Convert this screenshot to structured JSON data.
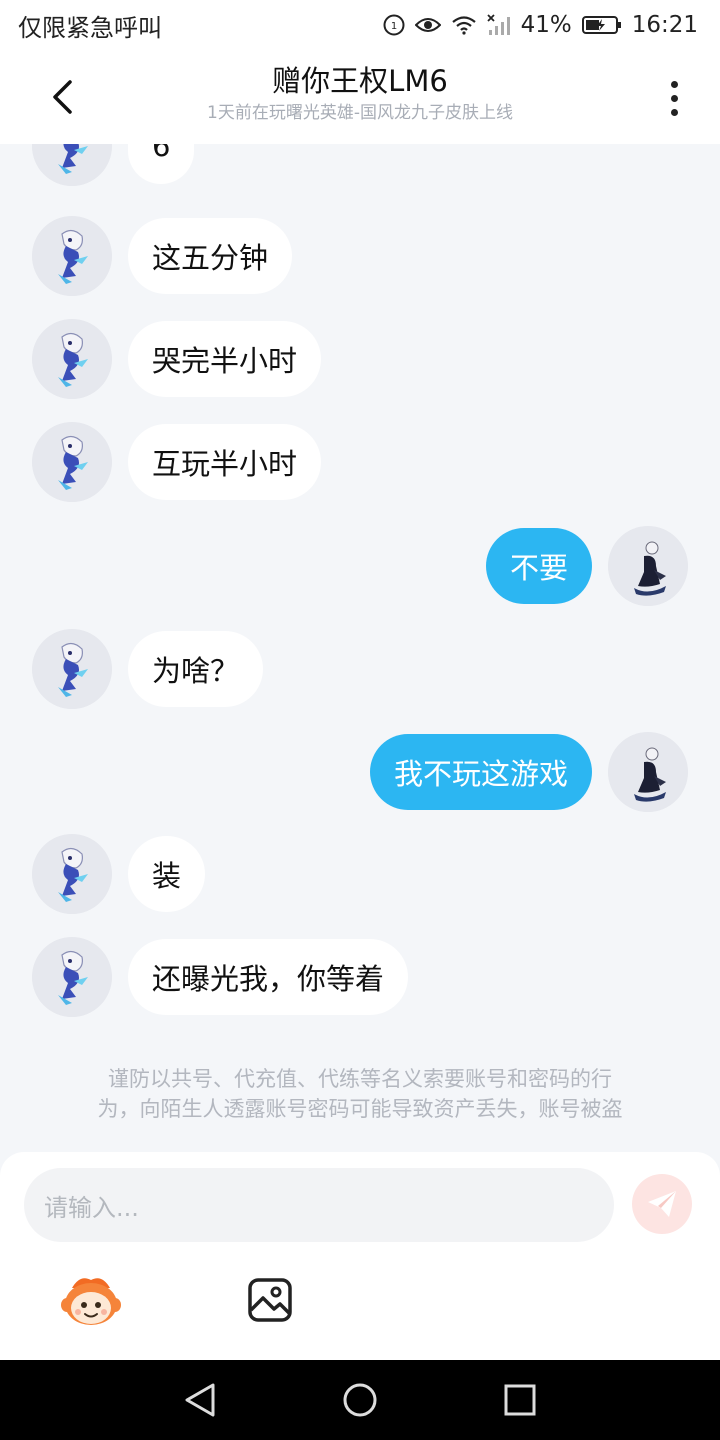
{
  "status_bar": {
    "left_text": "仅限紧急呼叫",
    "battery": "41%",
    "time": "16:21"
  },
  "header": {
    "title": "赠你王权LM6",
    "subtitle": "1天前在玩曙光英雄-国风龙九子皮肤上线"
  },
  "messages": [
    {
      "side": "left",
      "text": "6"
    },
    {
      "side": "left",
      "text": "这五分钟"
    },
    {
      "side": "left",
      "text": "哭完半小时"
    },
    {
      "side": "left",
      "text": "互玩半小时"
    },
    {
      "side": "right",
      "text": "不要"
    },
    {
      "side": "left",
      "text": "为啥？"
    },
    {
      "side": "right",
      "text": "我不玩这游戏"
    },
    {
      "side": "left",
      "text": "装"
    },
    {
      "side": "left",
      "text": "还曝光我，你等着"
    }
  ],
  "notice": {
    "line1": "谨防以共号、代充值、代练等名义索要账号和密码的行",
    "line2": "为，向陌生人透露账号密码可能导致资产丢失，账号被盗"
  },
  "composer": {
    "placeholder": "请输入..."
  },
  "icons": {
    "back": "chevron-left-icon",
    "more": "more-vertical-icon",
    "send": "send-icon",
    "emoji": "emoji-icon",
    "image": "image-icon"
  },
  "colors": {
    "my_bubble": "#2cb6f2",
    "their_bubble": "#ffffff",
    "background": "#f4f6f9",
    "send_button": "#fde4e2"
  }
}
